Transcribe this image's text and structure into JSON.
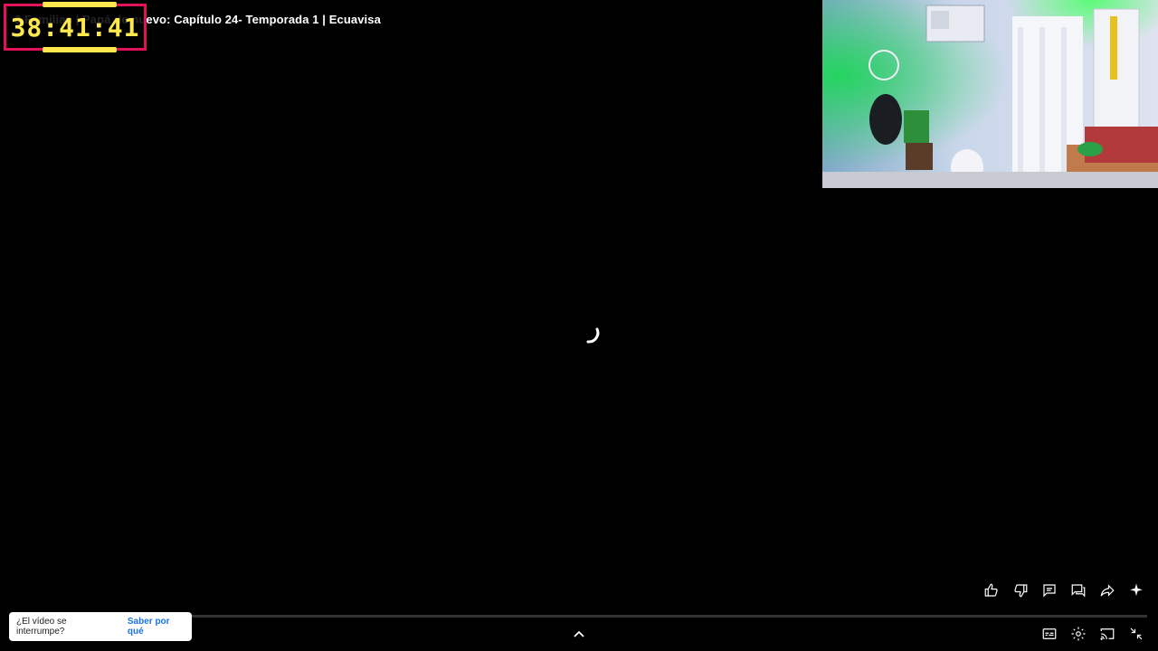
{
  "video": {
    "title": "3 Familias | Papá de nuevo: Capítulo 24- Temporada 1 | Ecuavisa"
  },
  "timer": {
    "value": "38:41:41",
    "accent_color": "#ffe84d",
    "border_color": "#e2115a"
  },
  "webcam": {
    "alt": "webcam-overlay"
  },
  "loading": {
    "spinner_icon": "loading-spinner-icon"
  },
  "actions": [
    {
      "icon": "thumbs-up-icon"
    },
    {
      "icon": "thumbs-down-icon"
    },
    {
      "icon": "comment-icon"
    },
    {
      "icon": "live-chat-icon"
    },
    {
      "icon": "share-icon"
    },
    {
      "icon": "sparkle-icon"
    }
  ],
  "toast": {
    "text": "¿El vídeo se interrumpe?",
    "link": "Saber por qué"
  },
  "bottom_controls": [
    {
      "icon": "subtitles-icon"
    },
    {
      "icon": "settings-gear-icon"
    },
    {
      "icon": "cast-icon"
    },
    {
      "icon": "exit-fullscreen-icon"
    }
  ]
}
